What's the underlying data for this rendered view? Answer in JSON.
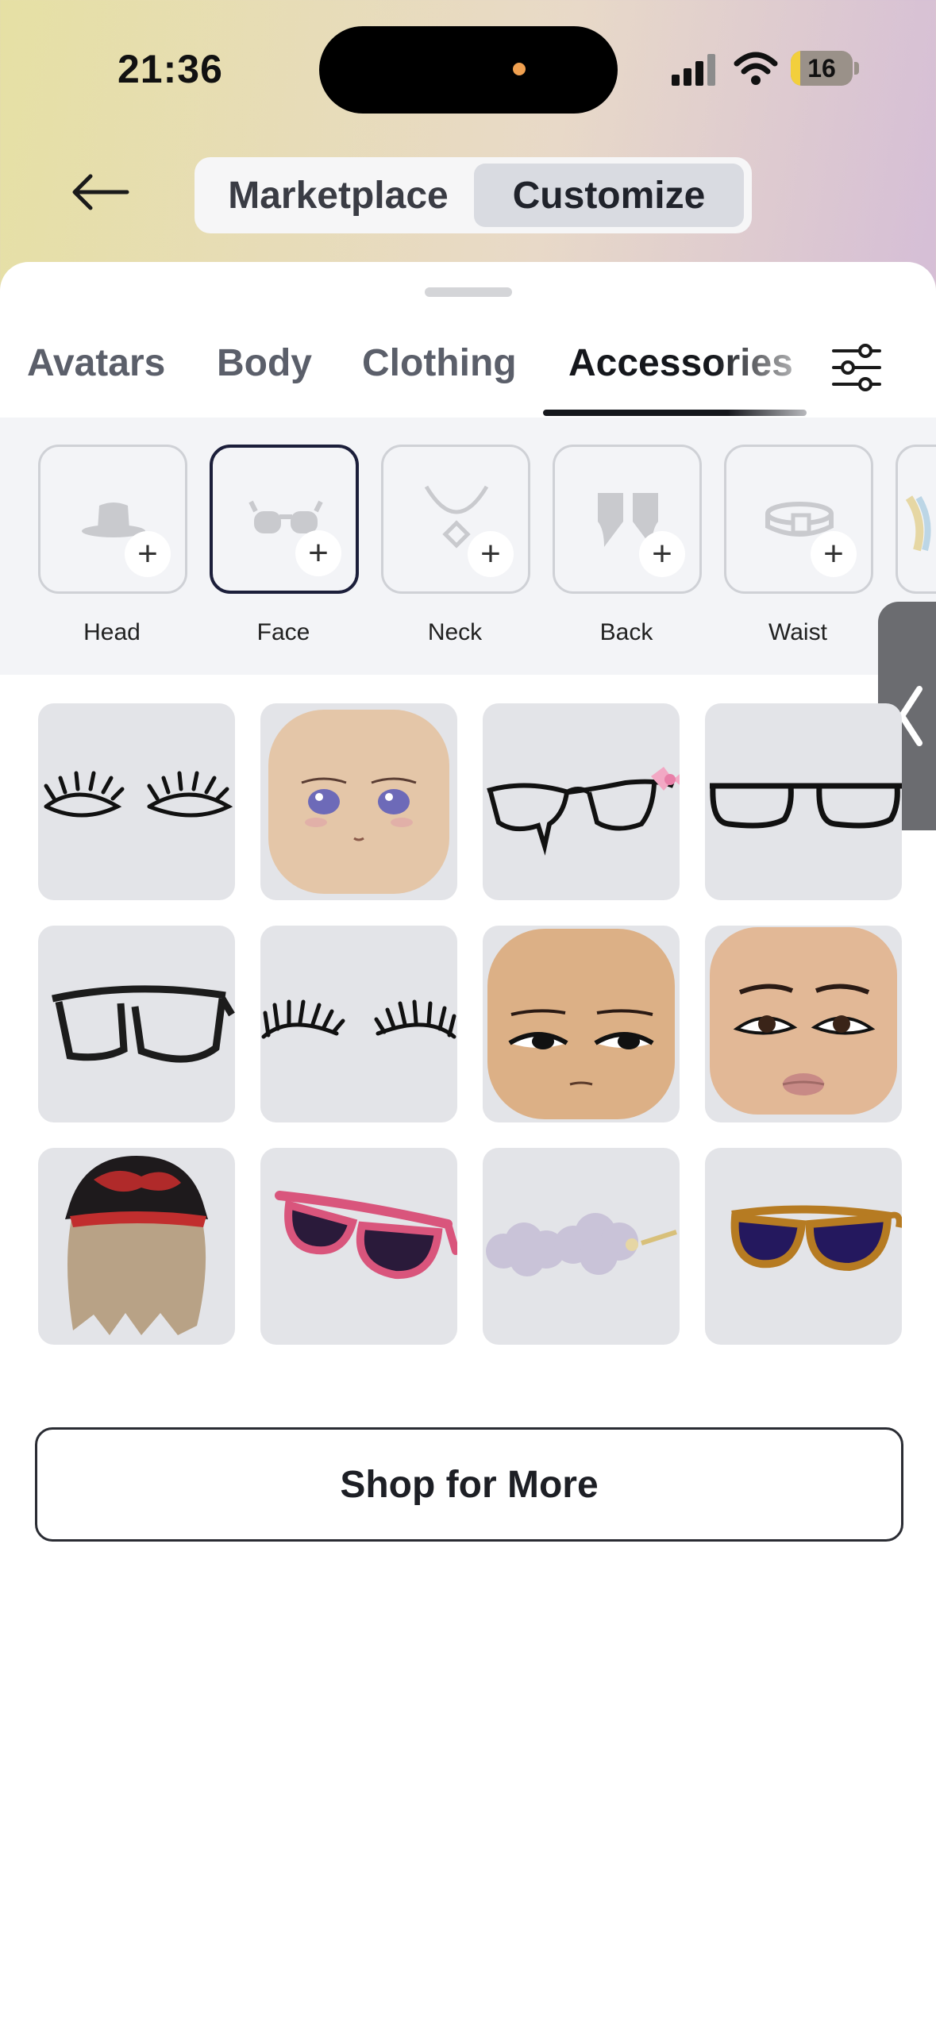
{
  "status_bar": {
    "time": "21:36",
    "battery": "16",
    "battery_level_pct": 16
  },
  "header": {
    "segments": [
      {
        "label": "Marketplace",
        "active": false
      },
      {
        "label": "Customize",
        "active": true
      }
    ]
  },
  "tabs": [
    {
      "label": "Avatars"
    },
    {
      "label": "Body"
    },
    {
      "label": "Clothing"
    },
    {
      "label": "Accessories",
      "active": true
    }
  ],
  "categories": [
    {
      "label": "Head",
      "icon": "hat-icon"
    },
    {
      "label": "Face",
      "icon": "glasses-icon",
      "selected": true
    },
    {
      "label": "Neck",
      "icon": "necklace-icon"
    },
    {
      "label": "Back",
      "icon": "wings-icon"
    },
    {
      "label": "Waist",
      "icon": "belt-icon"
    },
    {
      "label": "",
      "icon": "shoulder-icon"
    }
  ],
  "items": [
    {
      "name": "lashes-eyeliner-icon"
    },
    {
      "name": "anime-face-icon"
    },
    {
      "name": "drip-glasses-bow-icon"
    },
    {
      "name": "black-glasses-icon"
    },
    {
      "name": "black-wide-glasses-icon"
    },
    {
      "name": "long-lashes-icon"
    },
    {
      "name": "sleepy-face-icon"
    },
    {
      "name": "makeup-face-icon"
    },
    {
      "name": "cap-hair-icon"
    },
    {
      "name": "pink-sunglasses-icon"
    },
    {
      "name": "cloud-glasses-icon"
    },
    {
      "name": "gold-sunglasses-icon"
    }
  ],
  "shop_button": {
    "label": "Shop for More"
  },
  "colors": {
    "accent": "#1b1e3a",
    "tile_bg": "#e3e4e8",
    "strip_bg": "#f3f4f7"
  }
}
